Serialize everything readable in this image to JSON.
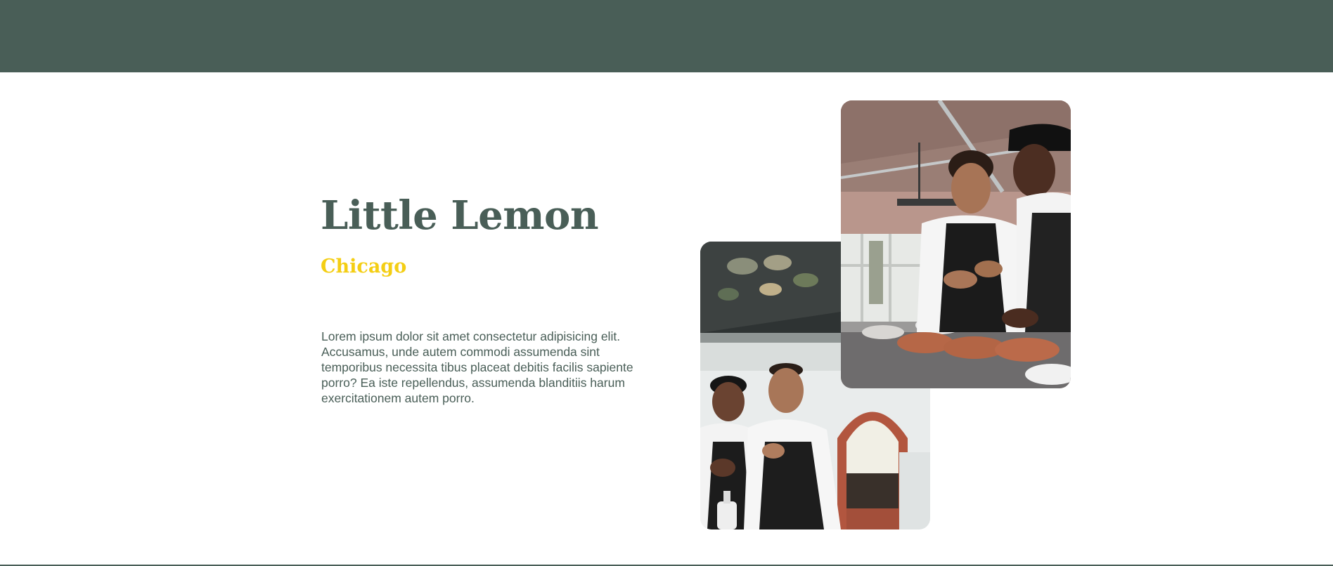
{
  "hero": {
    "title": "Little Lemon",
    "subtitle": "Chicago",
    "description": "Lorem ipsum dolor sit amet consectetur adipisicing elit. Accusamus, unde autem commodi assumenda sint temporibus necessita tibus placeat debitis facilis sapiente porro? Ea iste repellendus, assumenda blanditiis harum exercitationem autem porro."
  },
  "colors": {
    "brand_green": "#495e57",
    "brand_yellow": "#f4ce14",
    "background": "#ffffff"
  },
  "images": [
    {
      "name": "chefs-laughing-photo"
    },
    {
      "name": "chefs-talking-photo"
    }
  ]
}
